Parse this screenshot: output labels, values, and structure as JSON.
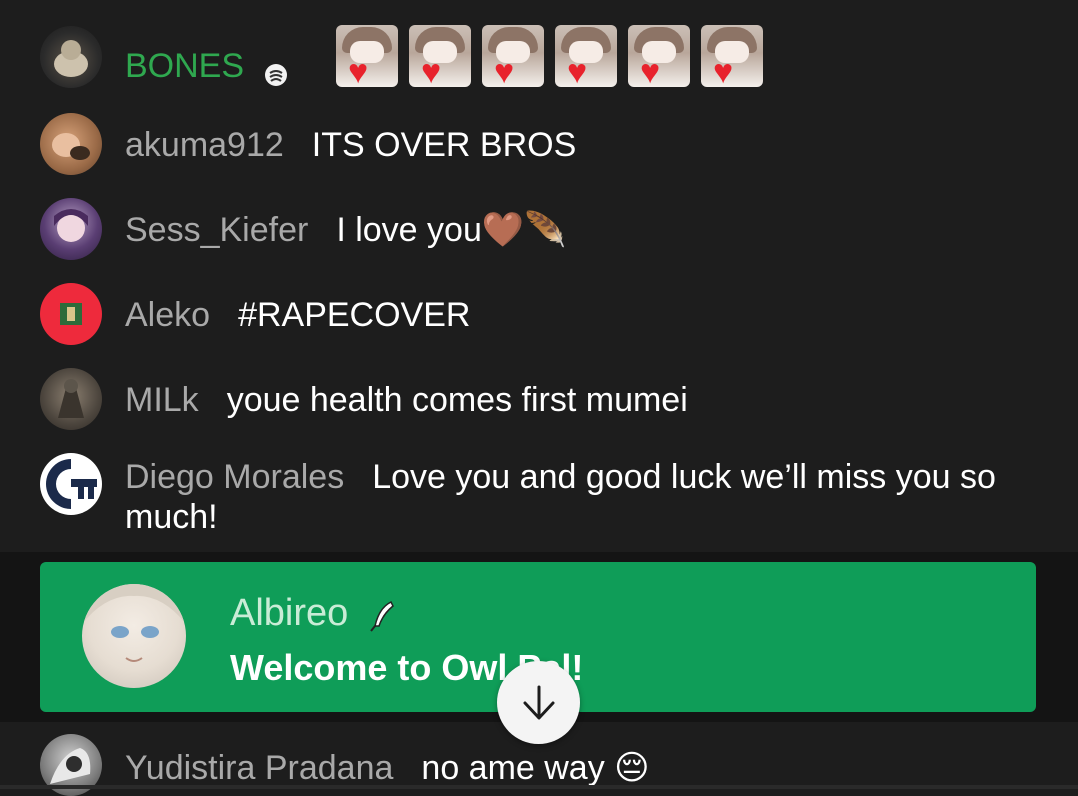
{
  "messages": [
    {
      "author": "BONES",
      "author_color": "#2fa84f",
      "badge_icon": "moderator-wrench-badge",
      "text": "",
      "stickers": 6
    },
    {
      "author": "akuma912",
      "text": "ITS OVER BROS"
    },
    {
      "author": "Sess_Kiefer",
      "text": "I love you🤎🪶"
    },
    {
      "author": "Aleko",
      "text": "#RAPECOVER"
    },
    {
      "author": "MILk",
      "text": "youe health comes first mumei"
    },
    {
      "author": "Diego Morales",
      "text": "Love you and good luck we’ll miss you so much!"
    },
    {
      "author": "Yudistira Pradana",
      "text": "no ame way 😔"
    }
  ],
  "banner": {
    "author": "Albireo",
    "author_icon": "feather-icon",
    "text": "Welcome to Owl Pal!",
    "background": "#0f9d58"
  },
  "scroll_button": {
    "icon": "arrow-down-icon"
  }
}
